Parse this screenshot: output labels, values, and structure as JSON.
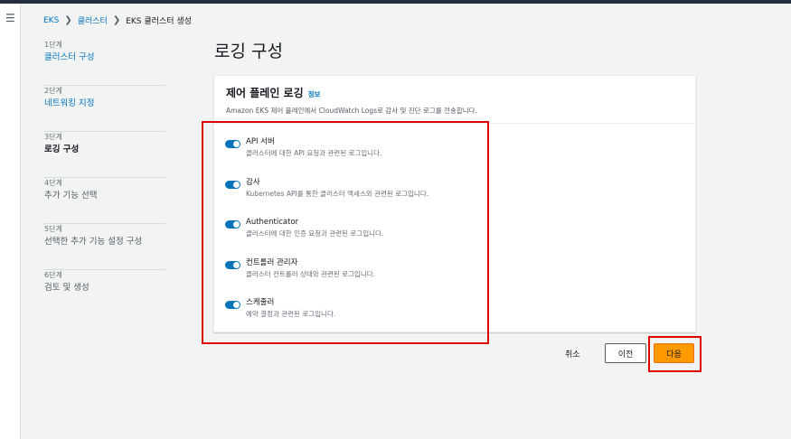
{
  "breadcrumb": {
    "items": [
      "EKS",
      "클러스터",
      "EKS 클러스터 생성"
    ]
  },
  "steps": [
    {
      "num": "1단계",
      "label": "클러스터 구성"
    },
    {
      "num": "2단계",
      "label": "네트워킹 지정"
    },
    {
      "num": "3단계",
      "label": "로깅 구성"
    },
    {
      "num": "4단계",
      "label": "추가 기능 선택"
    },
    {
      "num": "5단계",
      "label": "선택한 추가 기능 설정 구성"
    },
    {
      "num": "6단계",
      "label": "검토 및 생성"
    }
  ],
  "page_title": "로깅 구성",
  "panel": {
    "title": "제어 플레인 로깅",
    "info_link": "정보",
    "description": "Amazon EKS 제어 플레인에서 CloudWatch Logs로 감사 및 진단 로그를 전송합니다.",
    "toggles": [
      {
        "label": "API 서버",
        "desc": "클러스터에 대한 API 요청과 관련된 로그입니다.",
        "enabled": true
      },
      {
        "label": "감사",
        "desc": "Kubernetes API를 통한 클러스터 액세스와 관련된 로그입니다.",
        "enabled": true
      },
      {
        "label": "Authenticator",
        "desc": "클러스터에 대한 인증 요청과 관련된 로그입니다.",
        "enabled": true
      },
      {
        "label": "컨트롤러 관리자",
        "desc": "클러스터 컨트롤러 상태와 관련된 로그입니다.",
        "enabled": true
      },
      {
        "label": "스케줄러",
        "desc": "예약 결정과 관련된 로그입니다.",
        "enabled": true
      }
    ]
  },
  "actions": {
    "cancel": "취소",
    "previous": "이전",
    "next": "다음"
  },
  "colors": {
    "accent": "#0073bb",
    "primary_button": "#ff9900",
    "highlight": "#e00000"
  }
}
